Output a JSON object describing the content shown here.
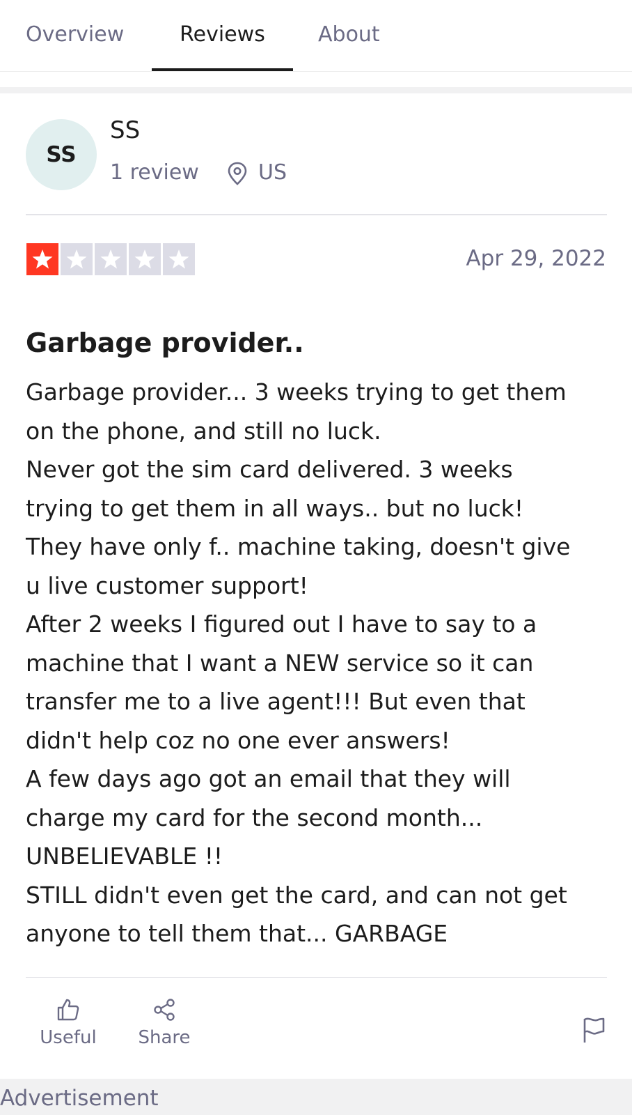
{
  "tabs": [
    {
      "label": "Overview",
      "active": false
    },
    {
      "label": "Reviews",
      "active": true
    },
    {
      "label": "About",
      "active": false
    }
  ],
  "reviewer": {
    "initials": "SS",
    "name": "SS",
    "review_count": "1 review",
    "country": "US",
    "location_icon": "map-pin-icon"
  },
  "review": {
    "rating": 1,
    "rating_max": 5,
    "rating_color": "#ff3722",
    "date": "Apr 29, 2022",
    "title": "Garbage provider..",
    "lines": [
      "Garbage provider... 3 weeks trying to get them",
      "on the phone, and still no luck.",
      "Never got the sim card delivered. 3 weeks",
      "trying to get them in all ways.. but no luck!",
      "They have only f.. machine taking, doesn't give",
      "u live customer support!",
      "After 2 weeks I figured out I have to say to a",
      "machine that I want a NEW service so it can",
      "transfer me to a live agent!!! But even that",
      "didn't help coz no one ever answers!",
      "A few days ago got an email that they will",
      "charge my card for the second month...",
      "UNBELIEVABLE !!",
      "STILL didn't even get the card, and can not get",
      "anyone to tell them that... GARBAGE"
    ]
  },
  "actions": {
    "useful_label": "Useful",
    "useful_icon": "thumbs-up-icon",
    "share_label": "Share",
    "share_icon": "share-icon",
    "flag_icon": "flag-icon"
  },
  "advertisement_label": "Advertisement"
}
